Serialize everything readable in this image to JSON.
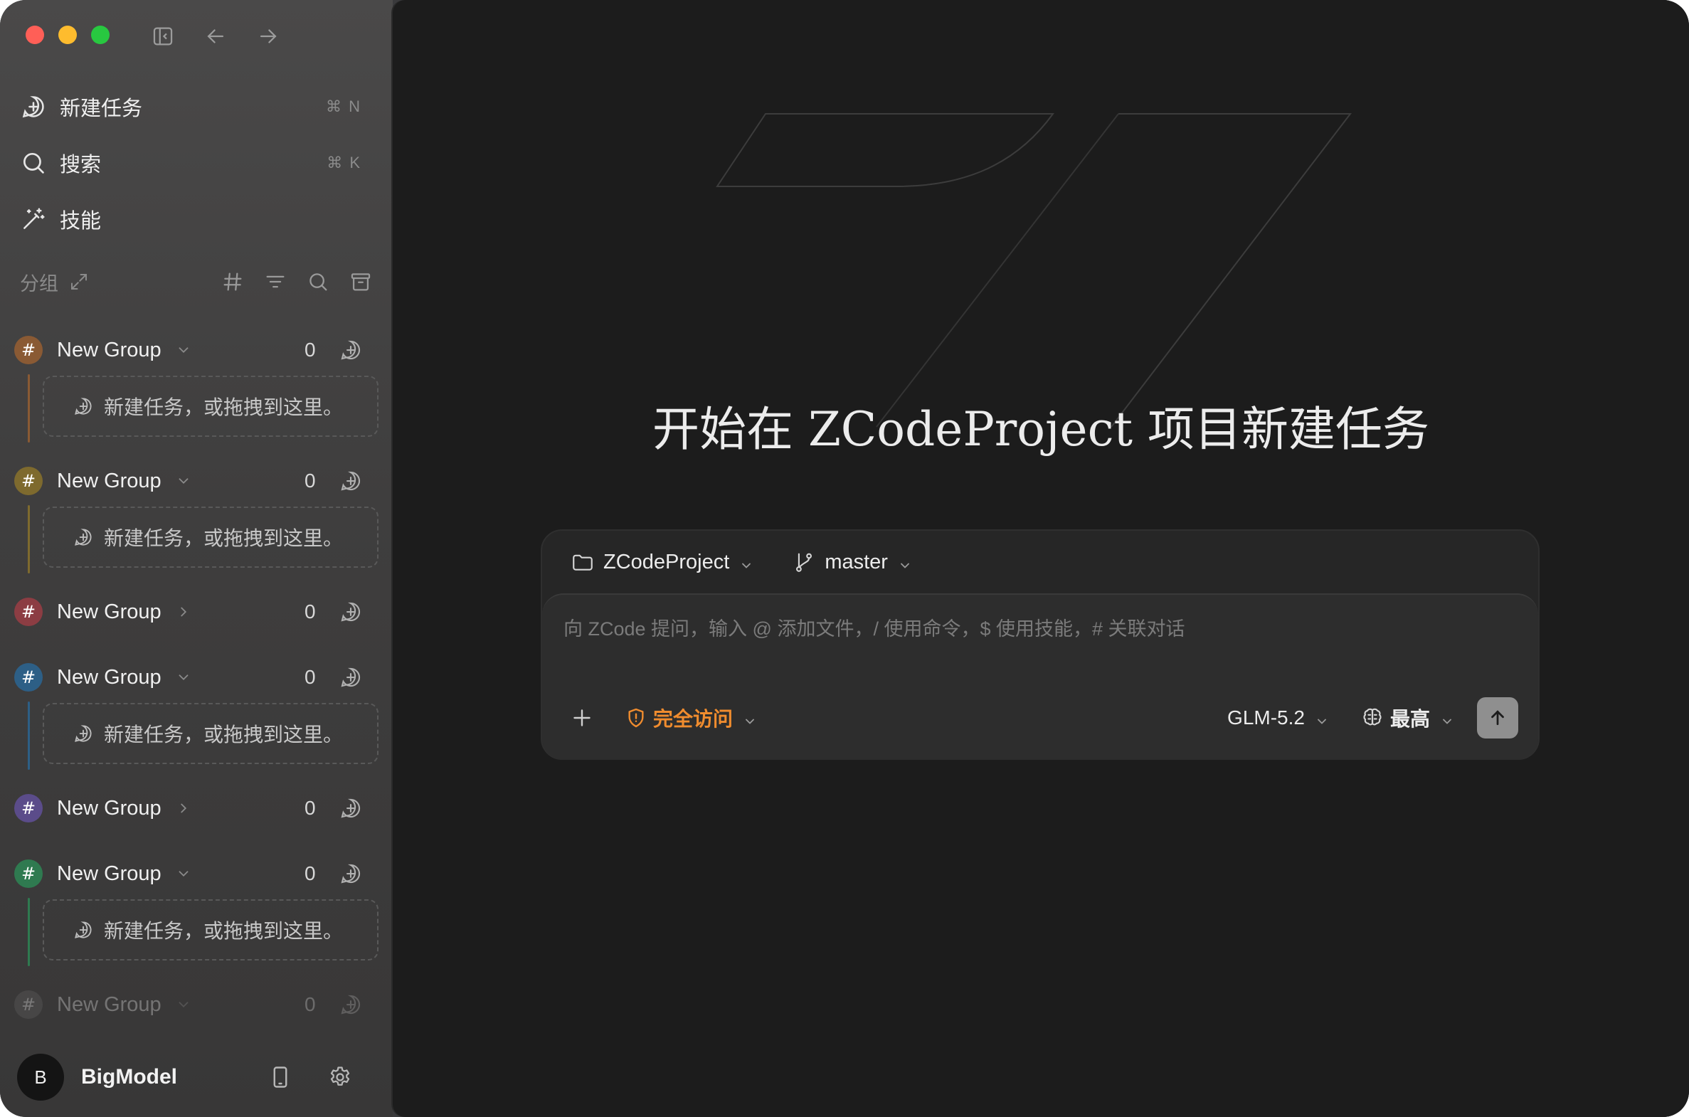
{
  "window": {
    "traffic_lights": {
      "close": "#ff5f57",
      "minimize": "#febc2e",
      "zoom": "#28c840"
    }
  },
  "sidebar": {
    "nav": [
      {
        "label": "新建任务",
        "shortcut": "⌘ N",
        "icon": "new-task-icon"
      },
      {
        "label": "搜索",
        "shortcut": "⌘ K",
        "icon": "search-icon"
      },
      {
        "label": "技能",
        "shortcut": "",
        "icon": "magic-wand-icon"
      }
    ],
    "groups_title": "分组",
    "groups": [
      {
        "name": "New Group",
        "count": "0",
        "color": "#8a5a34",
        "expanded": true,
        "placeholder": "新建任务，或拖拽到这里。"
      },
      {
        "name": "New Group",
        "count": "0",
        "color": "#7e6a2e",
        "expanded": true,
        "placeholder": "新建任务，或拖拽到这里。"
      },
      {
        "name": "New Group",
        "count": "0",
        "color": "#8c3d43",
        "expanded": false,
        "placeholder": ""
      },
      {
        "name": "New Group",
        "count": "0",
        "color": "#2d5f86",
        "expanded": true,
        "placeholder": "新建任务，或拖拽到这里。"
      },
      {
        "name": "New Group",
        "count": "0",
        "color": "#5b4c8a",
        "expanded": false,
        "placeholder": ""
      },
      {
        "name": "New Group",
        "count": "0",
        "color": "#2f7a50",
        "expanded": true,
        "placeholder": "新建任务，或拖拽到这里。"
      },
      {
        "name": "New Group",
        "count": "0",
        "color": "#666666",
        "expanded": true,
        "placeholder": ""
      }
    ],
    "group_hash": "#",
    "user": {
      "initial": "B",
      "name": "BigModel"
    }
  },
  "main": {
    "hero_title": "开始在 ZCodeProject 项目新建任务",
    "project": "ZCodeProject",
    "branch": "master",
    "prompt_placeholder": "向 ZCode 提问，输入 @ 添加文件，/ 使用命令，$ 使用技能，# 关联对话",
    "access_label": "完全访问",
    "model": "GLM-5.2",
    "effort": "最高",
    "accent_access": "#f08c2e"
  }
}
